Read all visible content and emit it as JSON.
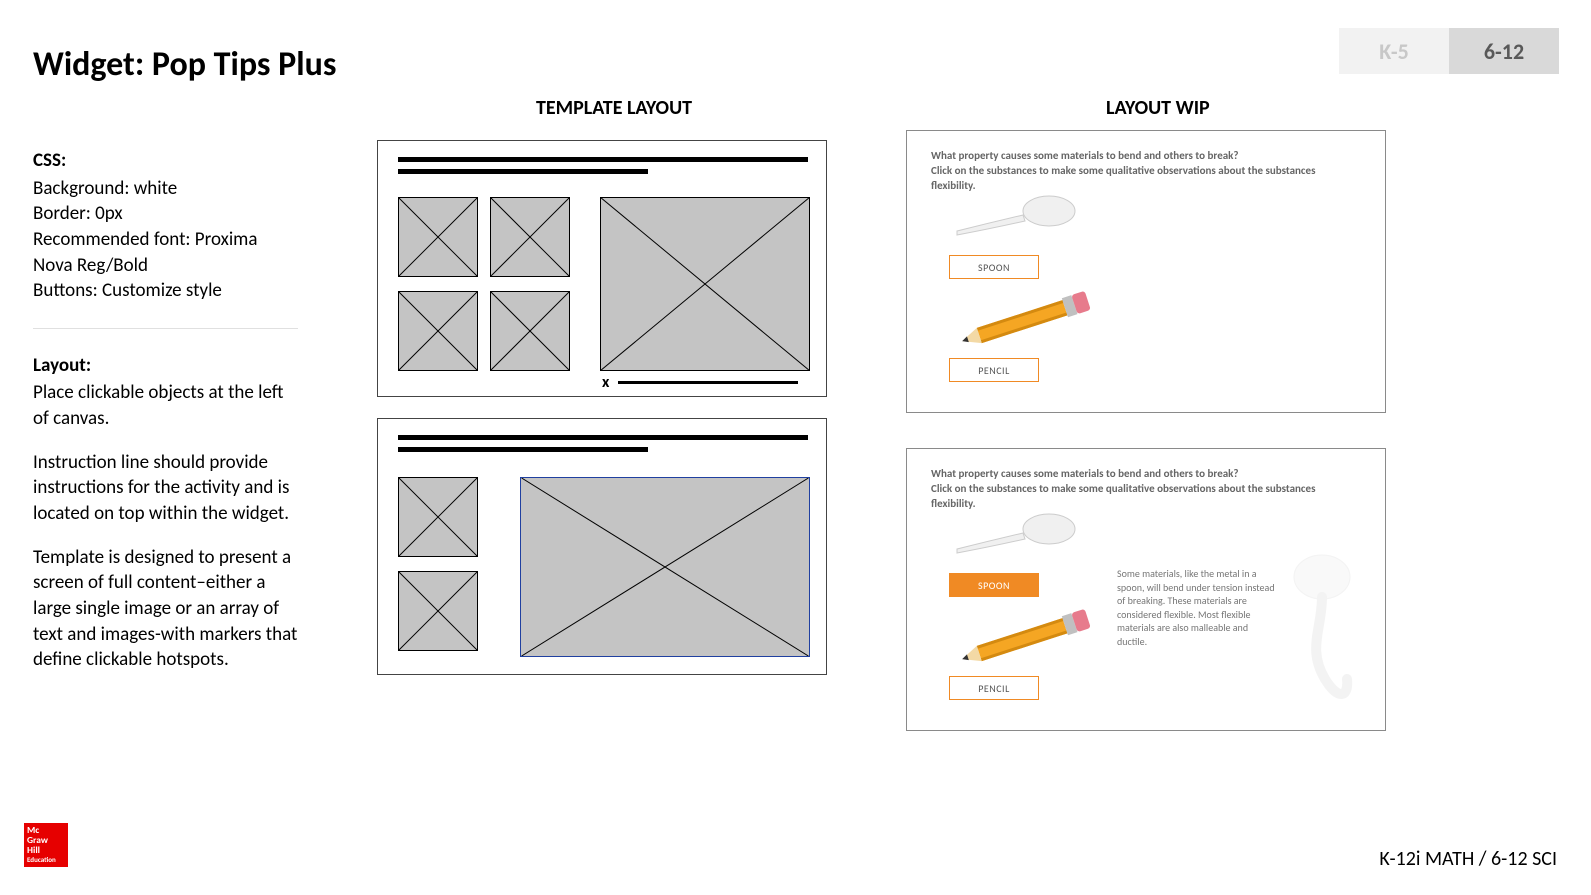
{
  "title": "Widget: Pop Tips Plus",
  "tabs": {
    "k5": "K-5",
    "g612": "6-12"
  },
  "headings": {
    "template": "TEMPLATE LAYOUT",
    "wip": "LAYOUT WIP"
  },
  "css": {
    "label": "CSS:",
    "lines": {
      "bg": "Background: white",
      "border": "Border: 0px",
      "font1": "Recommended font: Proxima",
      "font2": "Nova Reg/Bold",
      "buttons": "Buttons: Customize style"
    }
  },
  "layout": {
    "label": "Layout:",
    "p1": "Place clickable objects at the left of canvas.",
    "p2": "Instruction line should provide instructions for the activity and is located on top within the widget.",
    "p3": "Template is designed to present a screen of full content–either a large single image or an array of text and images-with markers that define clickable hotspots."
  },
  "logo": {
    "l1": "Mc",
    "l2": "Graw",
    "l3": "Hill",
    "l4": "Education"
  },
  "footer": "K-12i MATH / 6-12 SCI",
  "caption_x": "x",
  "wip": {
    "q1": "What property causes some materials to bend and others to break?",
    "q2": "Click on the substances to make some qualitative observations about the substances flexibility.",
    "spoon": "SPOON",
    "pencil": "PENCIL",
    "info": "Some materials, like the metal in a spoon, will bend under tension instead of breaking. These materials are considered flexible. Most flexible materials are also malleable and ductile."
  }
}
